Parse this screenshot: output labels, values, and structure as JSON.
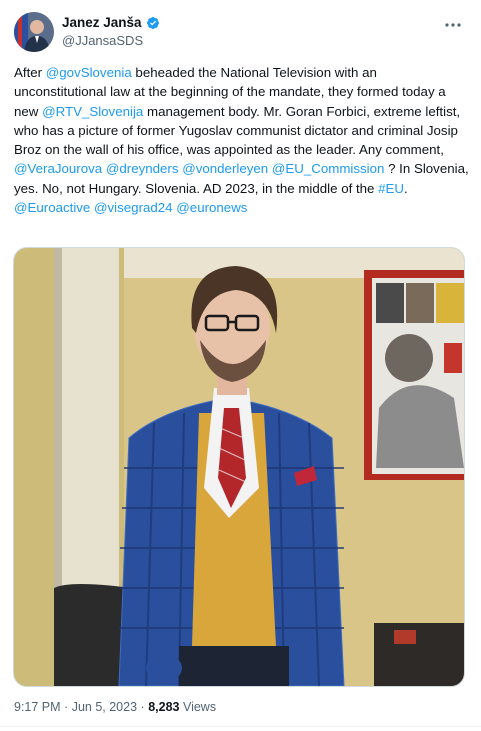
{
  "author": {
    "display_name": "Janez Janša",
    "handle": "@JJansaSDS",
    "verified": true,
    "avatar_icon": "profile-photo"
  },
  "tweet": {
    "segments": [
      {
        "text": "After ",
        "link": false
      },
      {
        "text": "@govSlovenia",
        "link": true
      },
      {
        "text": " beheaded the National Television with an unconstitutional law at the beginning of the mandate, they formed today a new ",
        "link": false
      },
      {
        "text": "@RTV_Slovenija",
        "link": true
      },
      {
        "text": " management body. Mr. Goran Forbici, extreme leftist, who has a picture of former Yugoslav communist dictator and criminal Josip Broz on the wall of his office, was appointed as the leader. Any comment, ",
        "link": false
      },
      {
        "text": "@VeraJourova",
        "link": true
      },
      {
        "text": " ",
        "link": false
      },
      {
        "text": "@dreynders",
        "link": true
      },
      {
        "text": " ",
        "link": false
      },
      {
        "text": "@vonderleyen",
        "link": true
      },
      {
        "text": " ",
        "link": false
      },
      {
        "text": "@EU_Commission",
        "link": true
      },
      {
        "text": " ? In Slovenia, yes. No, not Hungary. Slovenia. AD 2023, in the middle of the ",
        "link": false
      },
      {
        "text": "#EU",
        "link": true
      },
      {
        "text": ".",
        "link": false
      },
      {
        "text": "\n",
        "link": false
      },
      {
        "text": "@Euroactive",
        "link": true
      },
      {
        "text": " ",
        "link": false
      },
      {
        "text": "@visegrad24",
        "link": true
      },
      {
        "text": " ",
        "link": false
      },
      {
        "text": "@euronews",
        "link": true
      }
    ]
  },
  "meta": {
    "time": "9:17 PM",
    "separator": "·",
    "date": "Jun 5, 2023",
    "views_count": "8,283",
    "views_label": "Views"
  },
  "colors": {
    "link": "#1d9bf0",
    "text": "#0f1419",
    "secondary": "#536471",
    "verified": "#1d9bf0"
  }
}
